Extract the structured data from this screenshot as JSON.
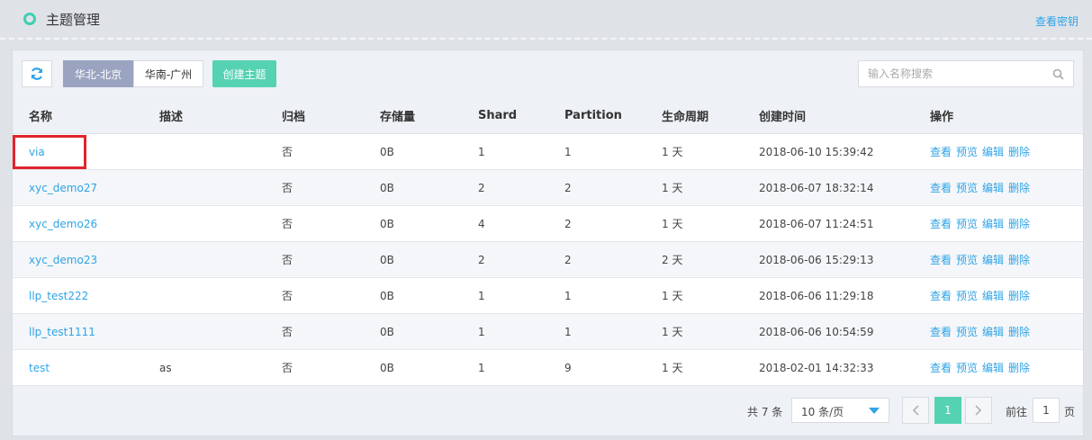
{
  "header": {
    "title": "主题管理",
    "view_key_link": "查看密钥"
  },
  "toolbar": {
    "regions": [
      "华北-北京",
      "华南-广州"
    ],
    "active_region": "华北-北京",
    "create_button": "创建主题",
    "search_placeholder": "输入名称搜索"
  },
  "table": {
    "columns": [
      "名称",
      "描述",
      "归档",
      "存储量",
      "Shard",
      "Partition",
      "生命周期",
      "创建时间",
      "操作"
    ],
    "actions": [
      "查看",
      "预览",
      "编辑",
      "删除"
    ],
    "rows": [
      {
        "name": "via",
        "desc": "",
        "archive": "否",
        "size": "0B",
        "shard": "1",
        "partition": "1",
        "lifecycle": "1 天",
        "created": "2018-06-10 15:39:42"
      },
      {
        "name": "xyc_demo27",
        "desc": "",
        "archive": "否",
        "size": "0B",
        "shard": "2",
        "partition": "2",
        "lifecycle": "1 天",
        "created": "2018-06-07 18:32:14"
      },
      {
        "name": "xyc_demo26",
        "desc": "",
        "archive": "否",
        "size": "0B",
        "shard": "4",
        "partition": "2",
        "lifecycle": "1 天",
        "created": "2018-06-07 11:24:51"
      },
      {
        "name": "xyc_demo23",
        "desc": "",
        "archive": "否",
        "size": "0B",
        "shard": "2",
        "partition": "2",
        "lifecycle": "2 天",
        "created": "2018-06-06 15:29:13"
      },
      {
        "name": "llp_test222",
        "desc": "",
        "archive": "否",
        "size": "0B",
        "shard": "1",
        "partition": "1",
        "lifecycle": "1 天",
        "created": "2018-06-06 11:29:18"
      },
      {
        "name": "llp_test1111",
        "desc": "",
        "archive": "否",
        "size": "0B",
        "shard": "1",
        "partition": "1",
        "lifecycle": "1 天",
        "created": "2018-06-06 10:54:59"
      },
      {
        "name": "test",
        "desc": "as",
        "archive": "否",
        "size": "0B",
        "shard": "1",
        "partition": "9",
        "lifecycle": "1 天",
        "created": "2018-02-01 14:32:33"
      }
    ]
  },
  "pagination": {
    "total_text": "共 7 条",
    "page_size": "10 条/页",
    "current_page": "1",
    "goto_label": "前往",
    "goto_value": "1",
    "page_suffix": "页"
  },
  "icons": {
    "refresh": "refresh-icon",
    "search": "search-icon",
    "prev": "chevron-left-icon",
    "next": "chevron-right-icon"
  },
  "colors": {
    "accent": "#55d2b2",
    "link": "#2fa4e7",
    "active_region": "#9aa4c0",
    "highlight": "#e0242b"
  }
}
